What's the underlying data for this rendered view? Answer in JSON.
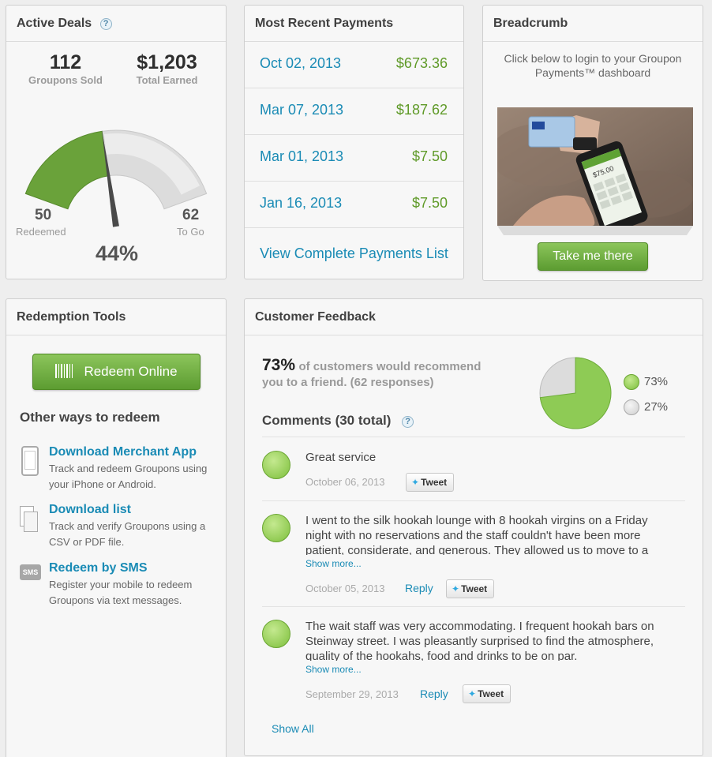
{
  "active_deals": {
    "title": "Active Deals",
    "help": "?",
    "groupons_sold_value": "112",
    "groupons_sold_label": "Groupons Sold",
    "total_earned_value": "$1,203",
    "total_earned_label": "Total Earned",
    "redeemed_value": "50",
    "redeemed_label": "Redeemed",
    "to_go_value": "62",
    "to_go_label": "To Go",
    "percent": "44%",
    "gauge_fraction": 0.44,
    "colors": {
      "redeemed": "#6aa23a",
      "remaining": "#d9d9d9"
    }
  },
  "payments": {
    "title": "Most Recent Payments",
    "rows": [
      {
        "date": "Oct 02, 2013",
        "amount": "$673.36"
      },
      {
        "date": "Mar 07, 2013",
        "amount": "$187.62"
      },
      {
        "date": "Mar 01, 2013",
        "amount": "$7.50"
      },
      {
        "date": "Jan 16, 2013",
        "amount": "$7.50"
      }
    ],
    "view_all": "View Complete Payments List"
  },
  "breadcrumb": {
    "title": "Breadcrumb",
    "text": "Click below to login to your Groupon Payments™ dashboard",
    "button": "Take me there",
    "screen_amount": "$75.00"
  },
  "redemption": {
    "title": "Redemption Tools",
    "redeem_button": "Redeem Online",
    "other_title": "Other ways to redeem",
    "items": [
      {
        "title": "Download Merchant App",
        "desc": "Track and redeem Groupons using your iPhone or Android.",
        "icon": "phone-icon"
      },
      {
        "title": "Download list",
        "desc": "Track and verify Groupons using a CSV or PDF file.",
        "icon": "document-icon"
      },
      {
        "title": "Redeem by SMS",
        "desc": "Register your mobile to redeem Groupons via text messages.",
        "icon": "sms-icon",
        "icon_text": "SMS"
      }
    ]
  },
  "feedback": {
    "title": "Customer Feedback",
    "recommend_percent": "73%",
    "recommend_text": "of customers would recommend",
    "recommend_text2": "you to a friend. (62 responses)",
    "positive_percent": "73%",
    "neutral_percent": "27%",
    "pie": {
      "positive_fraction": 0.73,
      "positive_color": "#8ecb55",
      "neutral_color": "#dcdcdc"
    },
    "comments_title": "Comments (30 total)",
    "help": "?",
    "comments": [
      {
        "text": "Great service",
        "date": "October 06, 2013",
        "reply": "",
        "tweet": "Tweet",
        "show_more": ""
      },
      {
        "text": "I went to the silk hookah lounge with 8 hookah virgins on a Friday night with no reservations and the staff couldn't have been more patient, considerate, and generous. They allowed us to move to a",
        "date": "October 05, 2013",
        "reply": "Reply",
        "tweet": "Tweet",
        "show_more": "Show more..."
      },
      {
        "text": "The wait staff was very accommodating. I frequent hookah bars on Steinway street. I was pleasantly surprised to find the atmosphere, quality of the hookahs, food and drinks to be on par.",
        "date": "September 29, 2013",
        "reply": "Reply",
        "tweet": "Tweet",
        "show_more": "Show more..."
      }
    ],
    "show_all": "Show All"
  }
}
